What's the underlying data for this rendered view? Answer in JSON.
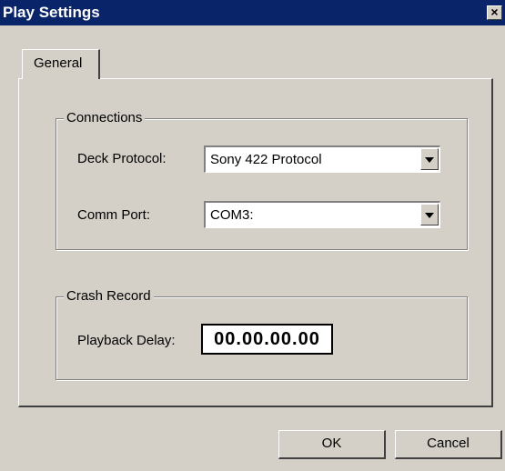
{
  "window": {
    "title": "Play Settings",
    "close_glyph": "×"
  },
  "tabs": [
    {
      "label": "General",
      "selected": true
    }
  ],
  "connections": {
    "group_label": "Connections",
    "deck_protocol": {
      "label": "Deck Protocol:",
      "value": "Sony 422 Protocol"
    },
    "comm_port": {
      "label": "Comm Port:",
      "value": "COM3:"
    }
  },
  "crash_record": {
    "group_label": "Crash Record",
    "playback_delay": {
      "label": "Playback Delay:",
      "value": "00.00.00.00"
    }
  },
  "buttons": {
    "ok": "OK",
    "cancel": "Cancel"
  },
  "colors": {
    "titlebar": "#0a246a",
    "face": "#d4d0c8"
  }
}
